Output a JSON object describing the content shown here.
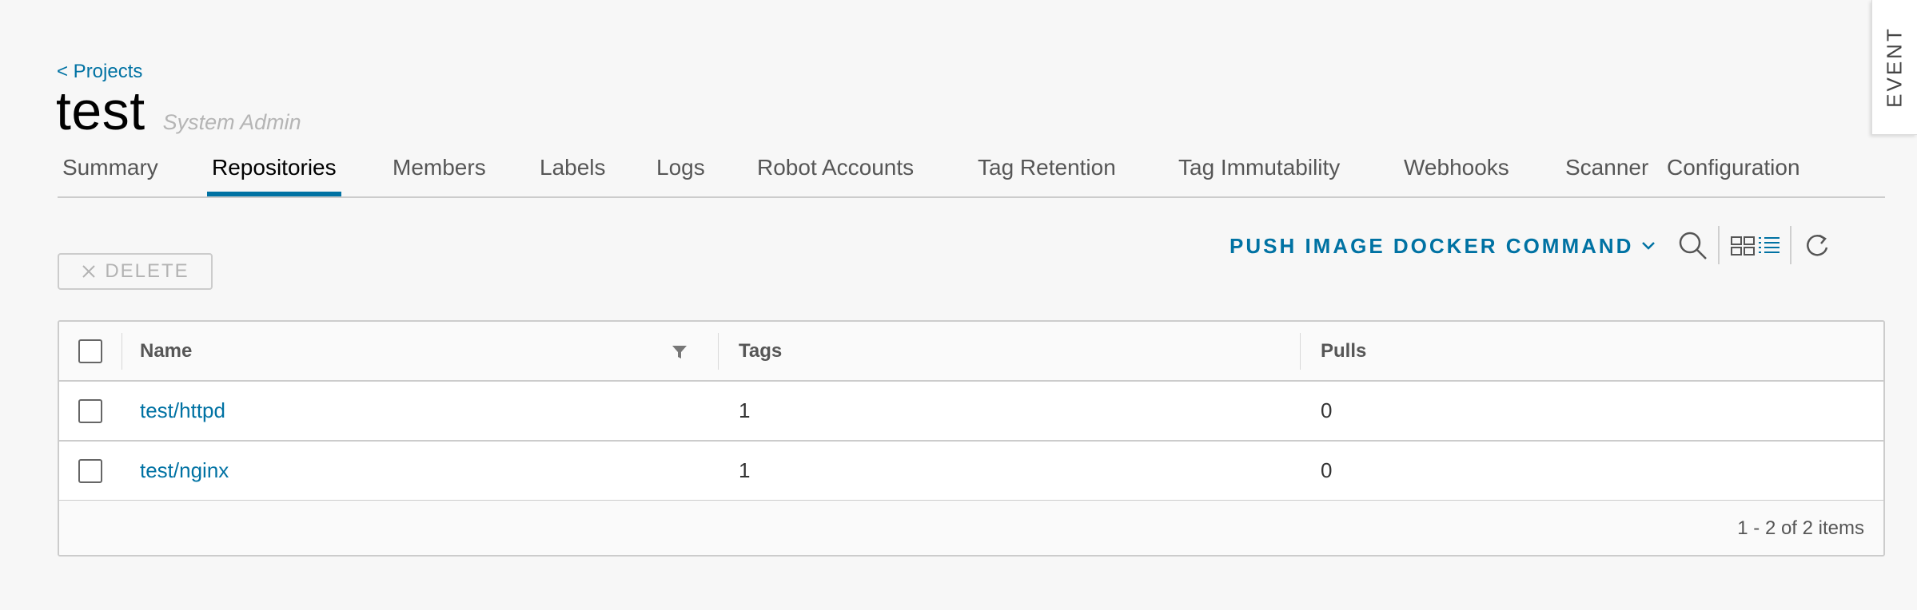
{
  "header": {
    "back_link": "< Projects",
    "project_name": "test",
    "role": "System Admin"
  },
  "tabs": [
    {
      "label": "Summary",
      "active": false
    },
    {
      "label": "Repositories",
      "active": true
    },
    {
      "label": "Members",
      "active": false
    },
    {
      "label": "Labels",
      "active": false
    },
    {
      "label": "Logs",
      "active": false
    },
    {
      "label": "Robot Accounts",
      "active": false
    },
    {
      "label": "Tag Retention",
      "active": false
    },
    {
      "label": "Tag Immutability",
      "active": false
    },
    {
      "label": "Webhooks",
      "active": false
    },
    {
      "label": "Scanner",
      "active": false
    },
    {
      "label": "Configuration",
      "active": false
    }
  ],
  "event_panel": {
    "label": "EVENT"
  },
  "toolbar": {
    "delete_label": "DELETE",
    "push_command_label": "PUSH IMAGE DOCKER COMMAND",
    "icons": [
      "search-icon",
      "card-view-icon",
      "list-view-icon",
      "refresh-icon"
    ]
  },
  "table": {
    "columns": [
      "Name",
      "Tags",
      "Pulls"
    ],
    "rows": [
      {
        "name": "test/httpd",
        "tags": "1",
        "pulls": "0"
      },
      {
        "name": "test/nginx",
        "tags": "1",
        "pulls": "0"
      }
    ],
    "footer": "1 - 2 of 2 items"
  },
  "colors": {
    "accent": "#0072a3",
    "background": "#f7f7f7",
    "border": "#cccccc",
    "muted_text": "#b5b5b5"
  }
}
